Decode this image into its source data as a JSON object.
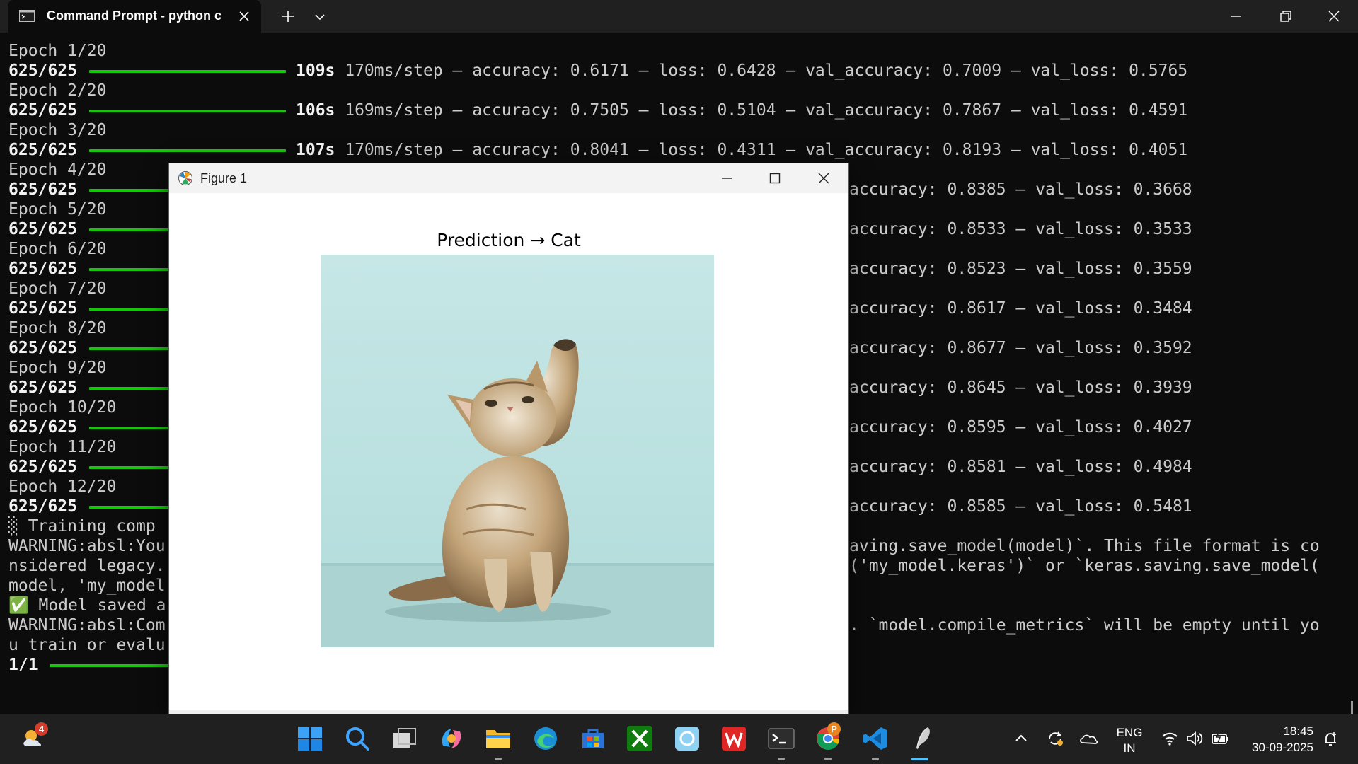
{
  "window": {
    "tab_title": "Command Prompt - python c",
    "icons": [
      "terminal-tab-icon",
      "close-icon",
      "plus-icon",
      "chevron-down-icon",
      "minimize-icon",
      "maximize-icon",
      "close-icon"
    ]
  },
  "terminal": {
    "epochs": [
      {
        "epoch": "Epoch 1/20",
        "steps": "625/625",
        "time": "109s",
        "step": "170ms/step",
        "accuracy": "0.6171",
        "loss": "0.6428",
        "val_accuracy": "0.7009",
        "val_loss": "0.5765"
      },
      {
        "epoch": "Epoch 2/20",
        "steps": "625/625",
        "time": "106s",
        "step": "169ms/step",
        "accuracy": "0.7505",
        "loss": "0.5104",
        "val_accuracy": "0.7867",
        "val_loss": "0.4591"
      },
      {
        "epoch": "Epoch 3/20",
        "steps": "625/625",
        "time": "107s",
        "step": "170ms/step",
        "accuracy": "0.8041",
        "loss": "0.4311",
        "val_accuracy": "0.8193",
        "val_loss": "0.4051"
      },
      {
        "epoch": "Epoch 4/20",
        "steps": "625/625",
        "val_accuracy": "0.8385",
        "val_loss": "0.3668"
      },
      {
        "epoch": "Epoch 5/20",
        "steps": "625/625",
        "val_accuracy": "0.8533",
        "val_loss": "0.3533"
      },
      {
        "epoch": "Epoch 6/20",
        "steps": "625/625",
        "val_accuracy": "0.8523",
        "val_loss": "0.3559"
      },
      {
        "epoch": "Epoch 7/20",
        "steps": "625/625",
        "val_accuracy": "0.8617",
        "val_loss": "0.3484"
      },
      {
        "epoch": "Epoch 8/20",
        "steps": "625/625",
        "val_accuracy": "0.8677",
        "val_loss": "0.3592"
      },
      {
        "epoch": "Epoch 9/20",
        "steps": "625/625",
        "val_accuracy": "0.8645",
        "val_loss": "0.3939"
      },
      {
        "epoch": "Epoch 10/20",
        "steps": "625/625",
        "val_accuracy": "0.8595",
        "val_loss": "0.4027"
      },
      {
        "epoch": "Epoch 11/20",
        "steps": "625/625",
        "val_accuracy": "0.8581",
        "val_loss": "0.4984"
      },
      {
        "epoch": "Epoch 12/20",
        "steps": "625/625",
        "val_accuracy": "0.8585",
        "val_loss": "0.5481"
      }
    ],
    "tail_lines_left": [
      "░ Training comp",
      "WARNING:absl:You",
      "nsidered legacy.",
      "model, 'my_model",
      "✅ Model saved a",
      "WARNING:absl:Com",
      "u train or evalu",
      "1/1"
    ],
    "tail_lines_right": [
      "",
      "aving.save_model(model)`. This file format is co",
      "('my_model.keras')` or `keras.saving.save_model(",
      "",
      "",
      ". `model.compile_metrics` will be empty until yo",
      "",
      ""
    ],
    "progress_color": "#16c60c",
    "labels": {
      "sep": " – ",
      "accuracy": "accuracy: ",
      "loss": "loss: ",
      "val_accuracy": "val_accuracy: ",
      "val_loss": "val_loss: ",
      "right_accuracy": "accuracy: "
    }
  },
  "figure": {
    "title": "Figure 1",
    "plot_title": "Prediction → Cat",
    "image_alt_icon": "cat-photo",
    "icons": [
      "matplotlib-icon",
      "minimize-icon",
      "maximize-icon",
      "close-icon"
    ]
  },
  "taskbar": {
    "weather_badge": "4",
    "chrome_badge": "P",
    "lang_line1": "ENG",
    "lang_line2": "IN",
    "time": "18:45",
    "date": "30-09-2025",
    "apps": [
      "weather-icon",
      "windows-start-icon",
      "search-icon",
      "task-view-icon",
      "copilot-icon",
      "file-explorer-icon",
      "edge-icon",
      "microsoft-store-icon",
      "xbox-icon",
      "photos-icon",
      "wps-office-icon",
      "terminal-icon",
      "chrome-icon",
      "vscode-icon",
      "python-feather-icon"
    ],
    "tray_icons": [
      "chevron-up-icon",
      "sync-icon",
      "onedrive-icon",
      "wifi-icon",
      "volume-icon",
      "battery-icon",
      "notification-icon"
    ]
  }
}
